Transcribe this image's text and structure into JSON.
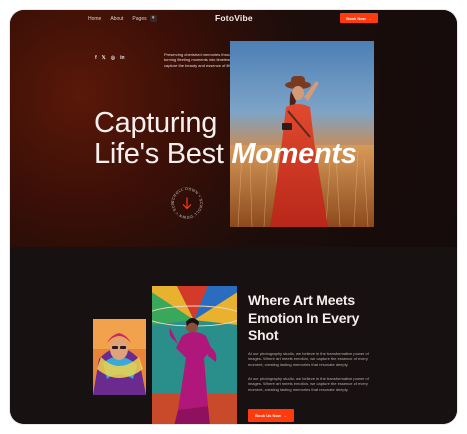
{
  "nav": {
    "items": [
      "Home",
      "About",
      "Pages"
    ],
    "caret": "▾",
    "brand": "FotoVibe",
    "book_label": "Book Now",
    "arrow": "→"
  },
  "hero": {
    "social": [
      "f",
      "𝕏",
      "◎",
      "in"
    ],
    "social_icons": [
      "facebook-icon",
      "twitter-icon",
      "instagram-icon",
      "linkedin-icon"
    ],
    "description": "Preserving cherished memories through the lens, turning fleeting moments into timeless images that capture the beauty and essence of life.",
    "headline_line1": "Capturing",
    "headline_line2": "Life's Best",
    "headline_emphasis": "Moments",
    "badge_text": "SCROLL DOWN • SCROLL DOWN • SCROLL DOWN • "
  },
  "about": {
    "title": "Where Art Meets Emotion In Every Shot",
    "paragraph1": "At our photography studio, we believe in the transformative power of images. Where art meets emotion, we capture the essence of every moment, creating lasting memories that resonate deeply.",
    "paragraph2": "At our photography studio, we believe in the transformative power of images. Where art meets emotion, we capture the essence of every moment, creating lasting memories that resonate deeply.",
    "button_label": "Book Us Now"
  },
  "colors": {
    "accent": "#ff3a0d",
    "background": "#151010",
    "text": "#f4ecea"
  }
}
